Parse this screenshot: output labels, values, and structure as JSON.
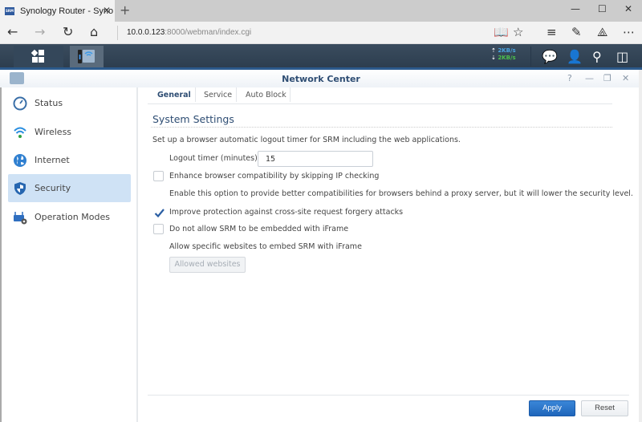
{
  "browser": {
    "tab_title": "Synology Router - Syno",
    "favicon_text": "SRM",
    "url_host": "10.0.0.123",
    "url_rest": ":8000/webman/index.cgi"
  },
  "taskbar": {
    "upload_speed": "2KB/s",
    "download_speed": "2KB/s"
  },
  "window": {
    "title": "Network Center"
  },
  "sidebar": {
    "items": [
      {
        "label": "Status",
        "icon": "gauge-icon"
      },
      {
        "label": "Wireless",
        "icon": "wifi-icon"
      },
      {
        "label": "Internet",
        "icon": "globe-icon"
      },
      {
        "label": "Security",
        "icon": "shield-icon",
        "active": true
      },
      {
        "label": "Operation Modes",
        "icon": "router-gear-icon"
      }
    ]
  },
  "tabs": [
    {
      "label": "General",
      "active": true
    },
    {
      "label": "Service"
    },
    {
      "label": "Auto Block"
    }
  ],
  "section": {
    "title": "System Settings",
    "description": "Set up a browser automatic logout timer for SRM including the web applications.",
    "logout_label": "Logout timer (minutes):",
    "logout_value": "15",
    "opt_compat_label": "Enhance browser compatibility by skipping IP checking",
    "opt_compat_checked": false,
    "opt_compat_desc": "Enable this option to provide better compatibilities for browsers behind a proxy server, but it will lower the security level.",
    "opt_csrf_label": "Improve protection against cross-site request forgery attacks",
    "opt_csrf_checked": true,
    "opt_iframe_label": "Do not allow SRM to be embedded with iFrame",
    "opt_iframe_checked": false,
    "iframe_desc": "Allow specific websites to embed SRM with iFrame",
    "allowed_websites_label": "Allowed websites"
  },
  "footer": {
    "apply_label": "Apply",
    "reset_label": "Reset"
  },
  "colors": {
    "accent": "#2e4d73",
    "apply": "#2c76cc",
    "active_item_bg": "#cfe2f5"
  }
}
